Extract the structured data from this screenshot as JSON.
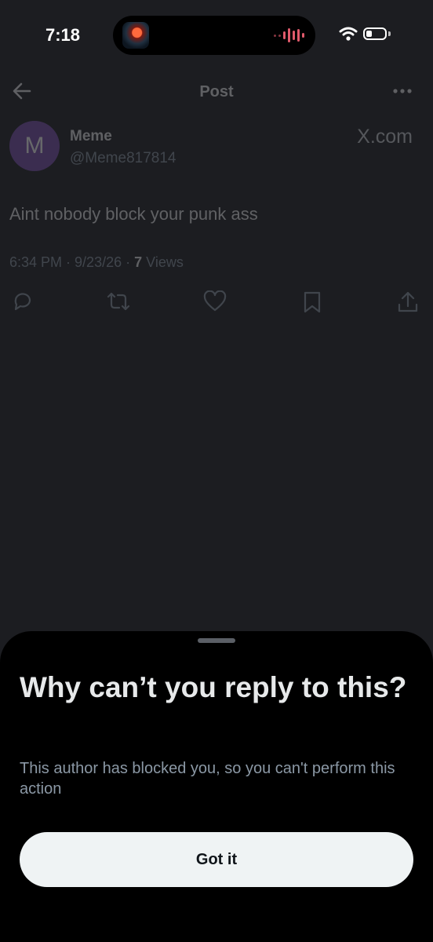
{
  "status_bar": {
    "time": "7:18",
    "icons": [
      "now-playing-art",
      "audio-wave-icon",
      "wifi-icon",
      "battery-icon"
    ]
  },
  "header": {
    "title": "Post",
    "icons": [
      "back-arrow-icon",
      "more-options-icon"
    ]
  },
  "post": {
    "avatar_letter": "M",
    "author_name": "Meme",
    "author_handle": "@Meme817814",
    "source_label": "X.com",
    "text": "Aint nobody block your punk ass",
    "time": "6:34 PM",
    "date": "9/23/26",
    "views_count": "7",
    "views_label": "Views",
    "actions": [
      "reply-icon",
      "repost-icon",
      "like-icon",
      "bookmark-icon",
      "share-icon"
    ]
  },
  "sheet": {
    "title": "Why can’t you reply to this?",
    "body": "This author has blocked you, so you can't perform this action",
    "button_label": "Got it"
  },
  "colors": {
    "background": "#1c1d21",
    "sheet_background": "#000000",
    "primary_text": "#e7e9ea",
    "secondary_text": "#8b98a5",
    "button_background": "#eff3f4",
    "avatar": "#7b4fb0"
  }
}
